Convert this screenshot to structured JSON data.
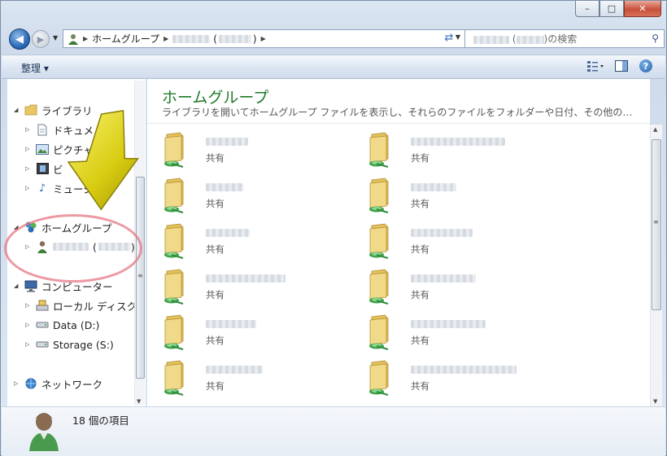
{
  "window": {
    "caption_buttons": {
      "minimize": "–",
      "maximize": "□",
      "close": "✕"
    }
  },
  "nav": {
    "back_glyph": "◀",
    "forward_glyph": "▶",
    "address": {
      "root_label": "ホームグループ",
      "tail": "(",
      "tail_close": ")"
    },
    "search_suffix": "の検索",
    "search_paren_open": "(",
    "search_paren_close": ")"
  },
  "toolbar": {
    "organize_label": "整理 ▾"
  },
  "sidebar": {
    "items": [
      {
        "label": "ライブラリ",
        "icon": "library-icon"
      },
      {
        "label": "ドキュメ",
        "icon": "document-icon"
      },
      {
        "label": "ピクチャ",
        "icon": "picture-icon"
      },
      {
        "label": "ビ",
        "icon": "video-icon"
      },
      {
        "label": "ミュージック",
        "icon": "music-icon"
      },
      {
        "label": "ホームグループ",
        "icon": "homegroup-icon"
      },
      {
        "label": "(",
        "label_close": ")",
        "icon": "user-icon"
      },
      {
        "label": "コンピューター",
        "icon": "computer-icon"
      },
      {
        "label": "ローカル ディスク",
        "icon": "local-disk-icon"
      },
      {
        "label": "Data (D:)",
        "icon": "drive-icon"
      },
      {
        "label": "Storage (S:)",
        "icon": "drive-icon"
      },
      {
        "label": "ネットワーク",
        "icon": "network-icon"
      }
    ]
  },
  "content": {
    "title": "ホームグループ",
    "description": "ライブラリを開いてホームグループ ファイルを表示し、それらのファイルをフォルダーや日付、その他の…",
    "tile_share_label": "共有"
  },
  "status": {
    "item_count": "18 個の項目"
  }
}
